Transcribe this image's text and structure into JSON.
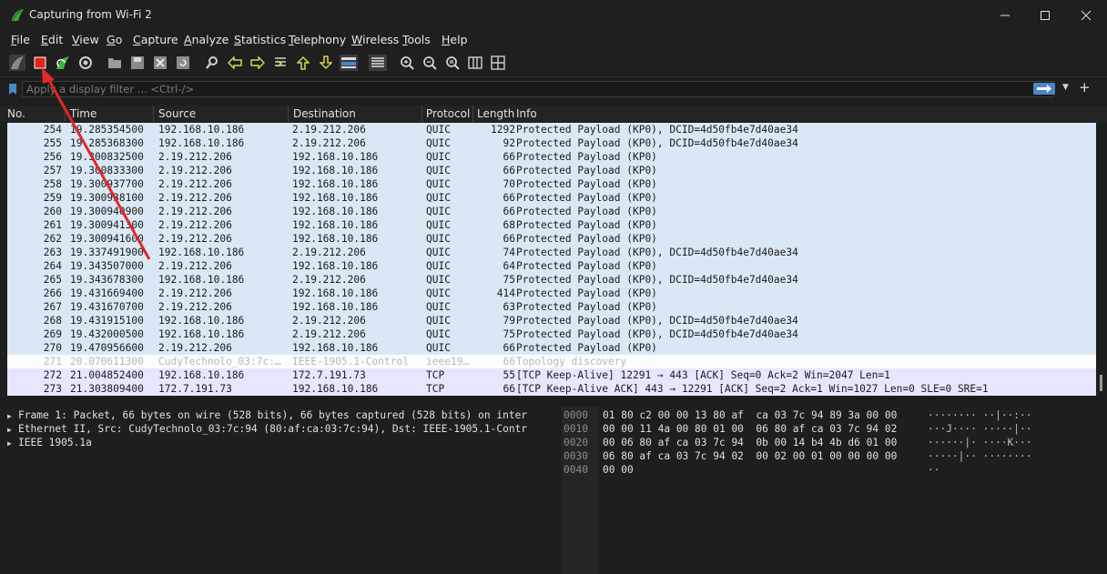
{
  "window": {
    "title": "Capturing from Wi-Fi 2",
    "controls": [
      "minimize",
      "maximize",
      "close"
    ]
  },
  "menu": [
    {
      "label": "File"
    },
    {
      "label": "Edit"
    },
    {
      "label": "View"
    },
    {
      "label": "Go"
    },
    {
      "label": "Capture"
    },
    {
      "label": "Analyze"
    },
    {
      "label": "Statistics"
    },
    {
      "label": "Telephony"
    },
    {
      "label": "Wireless"
    },
    {
      "label": "Tools"
    },
    {
      "label": "Help"
    }
  ],
  "toolbar_icons": [
    "shark-fin-icon",
    "stop-capture-icon",
    "restart-capture-icon",
    "capture-options-icon",
    "open-file-icon",
    "save-file-icon",
    "close-file-icon",
    "reload-file-icon",
    "find-packet-icon",
    "go-back-icon",
    "go-forward-icon",
    "go-to-packet-icon",
    "go-first-icon",
    "go-last-icon",
    "auto-scroll-icon",
    "colorize-icon",
    "zoom-in-icon",
    "zoom-out-icon",
    "normal-size-icon",
    "resize-columns-icon"
  ],
  "filter": {
    "placeholder": "Apply a display filter ... <Ctrl-/>"
  },
  "columns": {
    "no": "No.",
    "time": "Time",
    "source": "Source",
    "destination": "Destination",
    "protocol": "Protocol",
    "length": "Length",
    "info": "Info"
  },
  "packets": [
    {
      "no": "254",
      "time": "19.285354500",
      "src": "192.168.10.186",
      "dst": "2.19.212.206",
      "proto": "QUIC",
      "len": "1292",
      "info": "Protected Payload (KP0), DCID=4d50fb4e7d40ae34",
      "kind": "quic"
    },
    {
      "no": "255",
      "time": "19.285368300",
      "src": "192.168.10.186",
      "dst": "2.19.212.206",
      "proto": "QUIC",
      "len": "92",
      "info": "Protected Payload (KP0), DCID=4d50fb4e7d40ae34",
      "kind": "quic"
    },
    {
      "no": "256",
      "time": "19.300832500",
      "src": "2.19.212.206",
      "dst": "192.168.10.186",
      "proto": "QUIC",
      "len": "66",
      "info": "Protected Payload (KP0)",
      "kind": "quic"
    },
    {
      "no": "257",
      "time": "19.300833300",
      "src": "2.19.212.206",
      "dst": "192.168.10.186",
      "proto": "QUIC",
      "len": "66",
      "info": "Protected Payload (KP0)",
      "kind": "quic"
    },
    {
      "no": "258",
      "time": "19.300937700",
      "src": "2.19.212.206",
      "dst": "192.168.10.186",
      "proto": "QUIC",
      "len": "70",
      "info": "Protected Payload (KP0)",
      "kind": "quic"
    },
    {
      "no": "259",
      "time": "19.300938100",
      "src": "2.19.212.206",
      "dst": "192.168.10.186",
      "proto": "QUIC",
      "len": "66",
      "info": "Protected Payload (KP0)",
      "kind": "quic"
    },
    {
      "no": "260",
      "time": "19.300940900",
      "src": "2.19.212.206",
      "dst": "192.168.10.186",
      "proto": "QUIC",
      "len": "66",
      "info": "Protected Payload (KP0)",
      "kind": "quic"
    },
    {
      "no": "261",
      "time": "19.300941300",
      "src": "2.19.212.206",
      "dst": "192.168.10.186",
      "proto": "QUIC",
      "len": "68",
      "info": "Protected Payload (KP0)",
      "kind": "quic"
    },
    {
      "no": "262",
      "time": "19.300941600",
      "src": "2.19.212.206",
      "dst": "192.168.10.186",
      "proto": "QUIC",
      "len": "66",
      "info": "Protected Payload (KP0)",
      "kind": "quic"
    },
    {
      "no": "263",
      "time": "19.337491900",
      "src": "192.168.10.186",
      "dst": "2.19.212.206",
      "proto": "QUIC",
      "len": "74",
      "info": "Protected Payload (KP0), DCID=4d50fb4e7d40ae34",
      "kind": "quic"
    },
    {
      "no": "264",
      "time": "19.343507000",
      "src": "2.19.212.206",
      "dst": "192.168.10.186",
      "proto": "QUIC",
      "len": "64",
      "info": "Protected Payload (KP0)",
      "kind": "quic"
    },
    {
      "no": "265",
      "time": "19.343678300",
      "src": "192.168.10.186",
      "dst": "2.19.212.206",
      "proto": "QUIC",
      "len": "75",
      "info": "Protected Payload (KP0), DCID=4d50fb4e7d40ae34",
      "kind": "quic"
    },
    {
      "no": "266",
      "time": "19.431669400",
      "src": "2.19.212.206",
      "dst": "192.168.10.186",
      "proto": "QUIC",
      "len": "414",
      "info": "Protected Payload (KP0)",
      "kind": "quic"
    },
    {
      "no": "267",
      "time": "19.431670700",
      "src": "2.19.212.206",
      "dst": "192.168.10.186",
      "proto": "QUIC",
      "len": "63",
      "info": "Protected Payload (KP0)",
      "kind": "quic"
    },
    {
      "no": "268",
      "time": "19.431915100",
      "src": "192.168.10.186",
      "dst": "2.19.212.206",
      "proto": "QUIC",
      "len": "79",
      "info": "Protected Payload (KP0), DCID=4d50fb4e7d40ae34",
      "kind": "quic"
    },
    {
      "no": "269",
      "time": "19.432000500",
      "src": "192.168.10.186",
      "dst": "2.19.212.206",
      "proto": "QUIC",
      "len": "75",
      "info": "Protected Payload (KP0), DCID=4d50fb4e7d40ae34",
      "kind": "quic"
    },
    {
      "no": "270",
      "time": "19.470956600",
      "src": "2.19.212.206",
      "dst": "192.168.10.186",
      "proto": "QUIC",
      "len": "66",
      "info": "Protected Payload (KP0)",
      "kind": "quic"
    },
    {
      "no": "271",
      "time": "20.070611300",
      "src": "CudyTechnolo_03:7c:…",
      "dst": "IEEE-1905.1-Control",
      "proto": "ieee19…",
      "len": "66",
      "info": "Topology discovery",
      "kind": "ieee"
    },
    {
      "no": "272",
      "time": "21.004852400",
      "src": "192.168.10.186",
      "dst": "172.7.191.73",
      "proto": "TCP",
      "len": "55",
      "info": "[TCP Keep-Alive] 12291 → 443 [ACK] Seq=0 Ack=2 Win=2047 Len=1",
      "kind": "tcp"
    },
    {
      "no": "273",
      "time": "21.303809400",
      "src": "172.7.191.73",
      "dst": "192.168.10.186",
      "proto": "TCP",
      "len": "66",
      "info": "[TCP Keep-Alive ACK] 443 → 12291 [ACK] Seq=2 Ack=1 Win=1027 Len=0 SLE=0 SRE=1",
      "kind": "tcp"
    }
  ],
  "details": [
    "Frame 1: Packet, 66 bytes on wire (528 bits), 66 bytes captured (528 bits) on inter",
    "Ethernet II, Src: CudyTechnolo_03:7c:94 (80:af:ca:03:7c:94), Dst: IEEE-1905.1-Contr",
    "IEEE 1905.1a"
  ],
  "bytes": [
    {
      "offset": "0000",
      "hex": "01 80 c2 00 00 13 80 af  ca 03 7c 94 89 3a 00 00",
      "ascii": "········ ··|··:··"
    },
    {
      "offset": "0010",
      "hex": "00 00 11 4a 00 80 01 00  06 80 af ca 03 7c 94 02",
      "ascii": "···J···· ·····|··"
    },
    {
      "offset": "0020",
      "hex": "00 06 80 af ca 03 7c 94  0b 00 14 b4 4b d6 01 00",
      "ascii": "······|· ····K···"
    },
    {
      "offset": "0030",
      "hex": "06 80 af ca 03 7c 94 02  00 02 00 01 00 00 00 00",
      "ascii": "·····|·· ········"
    },
    {
      "offset": "0040",
      "hex": "00 00",
      "ascii": "··"
    }
  ],
  "colors": {
    "quic_row": "#dae8f6",
    "ieee_row": "#fcfcfc",
    "tcp_row": "#e7e6ff",
    "annotation_arrow": "#e0282a"
  }
}
